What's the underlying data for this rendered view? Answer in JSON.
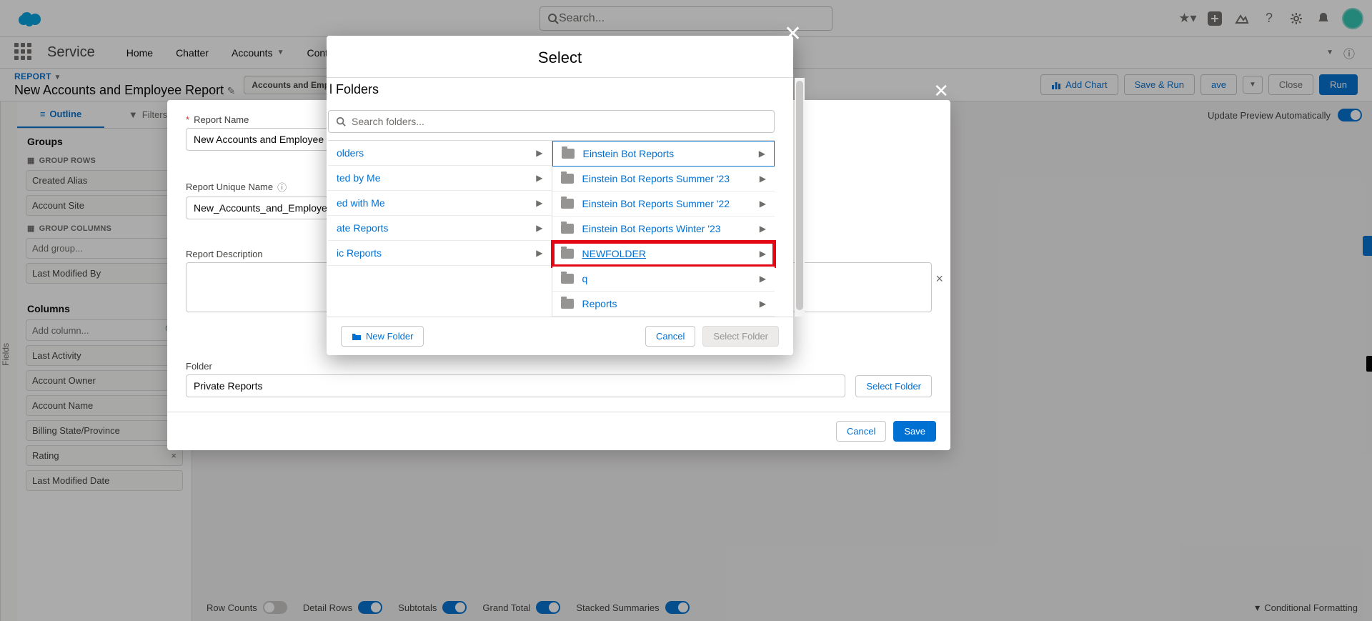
{
  "header": {
    "search_placeholder": "Search..."
  },
  "app": {
    "name": "Service",
    "nav": {
      "home": "Home",
      "chatter": "Chatter",
      "accounts": "Accounts",
      "contacts": "Contacts"
    }
  },
  "report_head": {
    "label": "REPORT",
    "title": "New Accounts and Employee Report",
    "type_pill": "Accounts and Employe",
    "add_chart": "Add Chart",
    "save_run": "Save & Run",
    "save": "ave",
    "close": "Close",
    "run": "Run"
  },
  "side": {
    "fields_rail": "Fields",
    "tab_outline": "Outline",
    "tab_filters": "Filters",
    "groups_heading": "Groups",
    "group_rows": "GROUP ROWS",
    "rows": {
      "a": "Created Alias",
      "b": "Account Site"
    },
    "group_cols": "GROUP COLUMNS",
    "add_group": "Add group...",
    "last_mod_by": "Last Modified By",
    "columns_heading": "Columns",
    "add_column": "Add column...",
    "cols": {
      "a": "Last Activity",
      "b": "Account Owner",
      "c": "Account Name",
      "d": "Billing State/Province",
      "e": "Rating",
      "f": "Last Modified Date"
    }
  },
  "preview": {
    "label": "Update Preview Automatically"
  },
  "footer": {
    "row_counts": "Row Counts",
    "detail_rows": "Detail Rows",
    "subtotals": "Subtotals",
    "grand_total": "Grand Total",
    "stacked": "Stacked Summaries",
    "cond_fmt": "Conditional Formatting"
  },
  "save_dialog": {
    "report_name_label": "Report Name",
    "report_name_value": "New Accounts and Employee R",
    "unique_label": "Report Unique Name",
    "unique_value": "New_Accounts_and_Employee_",
    "desc_label": "Report Description",
    "folder_label": "Folder",
    "folder_value": "Private Reports",
    "select_folder": "Select Folder",
    "cancel": "Cancel",
    "save": "Save"
  },
  "picker": {
    "title": "Select",
    "section": "Folders",
    "search_placeholder": "Search folders...",
    "left": {
      "a": "olders",
      "b": "ted by Me",
      "c": "ed with Me",
      "d": "ate Reports",
      "e": "ic Reports"
    },
    "right": {
      "a": "Einstein Bot Reports",
      "b": "Einstein Bot Reports Summer '23",
      "c": "Einstein Bot Reports Summer '22",
      "d": "Einstein Bot Reports Winter '23",
      "e": "NEWFOLDER",
      "f": "q",
      "g": "Reports"
    },
    "new_folder": "New Folder",
    "cancel": "Cancel",
    "select": "Select Folder"
  }
}
